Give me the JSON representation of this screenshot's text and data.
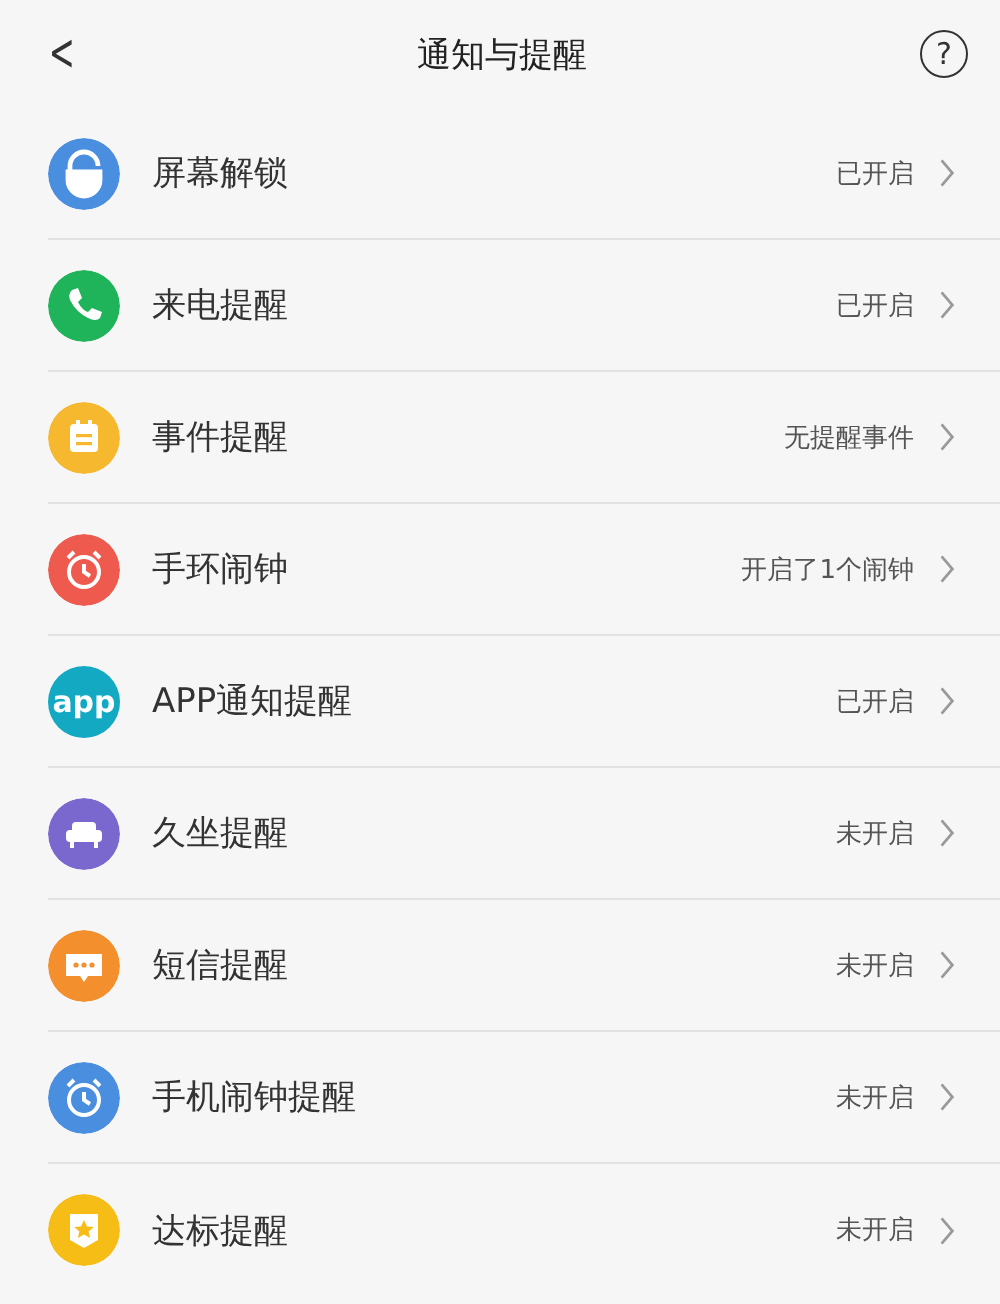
{
  "header": {
    "title": "通知与提醒",
    "back_glyph": "<",
    "help_glyph": "?"
  },
  "items": [
    {
      "kind": "lock",
      "color": "#4a8ee0",
      "label": "屏幕解锁",
      "status": "已开启"
    },
    {
      "kind": "phone",
      "color": "#1fb45a",
      "label": "来电提醒",
      "status": "已开启"
    },
    {
      "kind": "calendar",
      "color": "#f5b82e",
      "label": "事件提醒",
      "status": "无提醒事件"
    },
    {
      "kind": "alarm",
      "color": "#ef5a4e",
      "label": "手环闹钟",
      "status": "开启了1个闹钟"
    },
    {
      "kind": "app",
      "color": "#13a9c2",
      "icon_text": "app",
      "label": "APP通知提醒",
      "status": "已开启"
    },
    {
      "kind": "sofa",
      "color": "#7b68cf",
      "label": "久坐提醒",
      "status": "未开启"
    },
    {
      "kind": "message",
      "color": "#f48f2e",
      "label": "短信提醒",
      "status": "未开启"
    },
    {
      "kind": "alarm",
      "color": "#4a8ee0",
      "label": "手机闹钟提醒",
      "status": "未开启"
    },
    {
      "kind": "badge",
      "color": "#f5bd16",
      "label": "达标提醒",
      "status": "未开启"
    }
  ]
}
